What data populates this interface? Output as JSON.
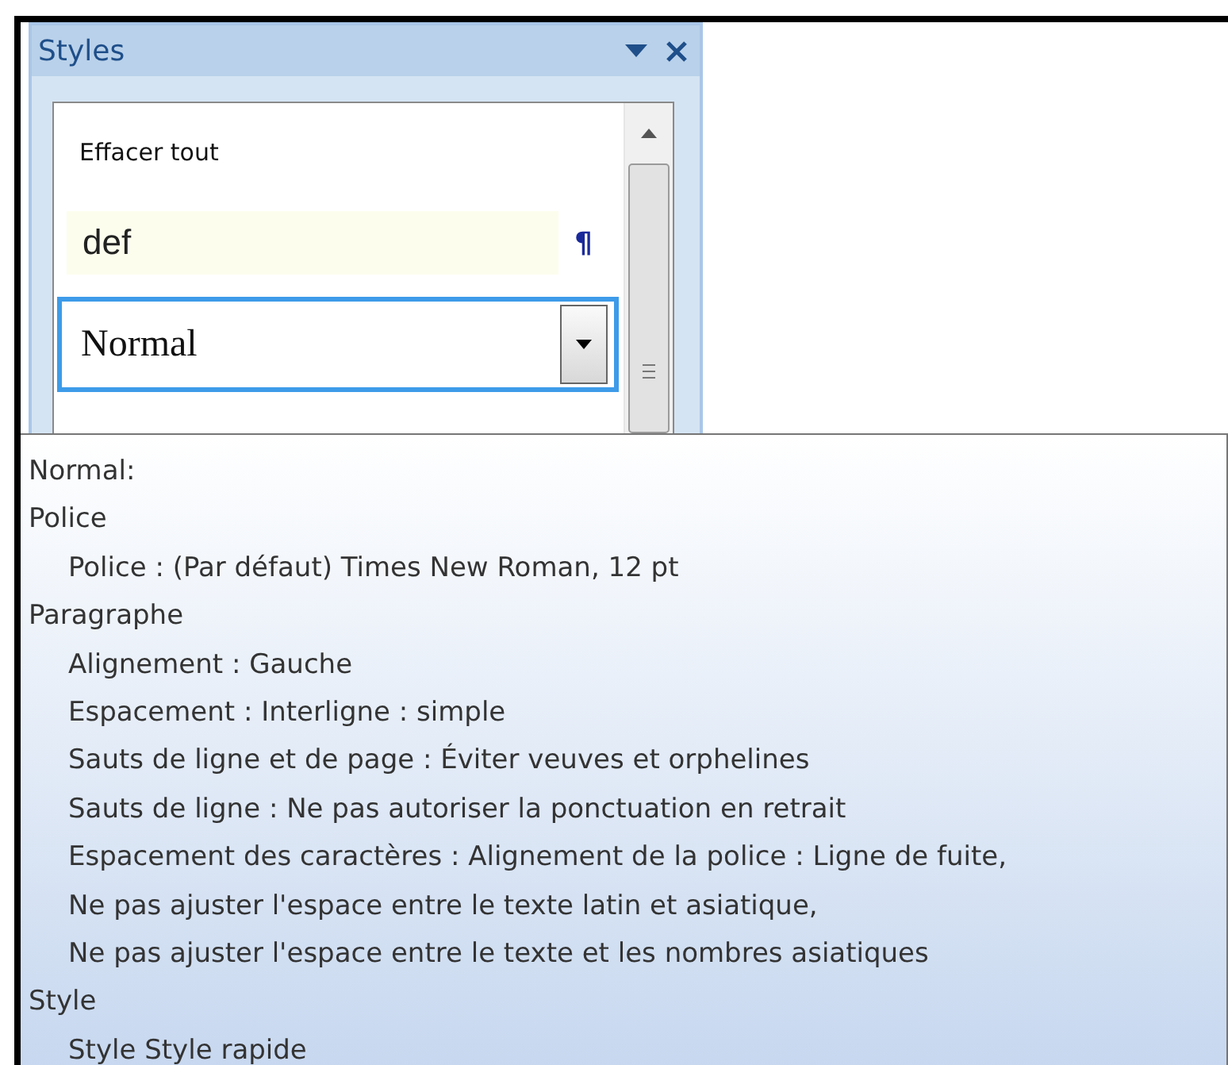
{
  "pane": {
    "title": "Styles",
    "styles": [
      {
        "kind": "command",
        "label": "Effacer tout",
        "highlighted": false
      },
      {
        "kind": "paragraph",
        "label": "def",
        "symbol": "¶",
        "highlighted": true
      },
      {
        "kind": "dropdown",
        "label": "Normal",
        "highlighted": false
      }
    ]
  },
  "tooltip": {
    "title": "Normal:",
    "sections": [
      {
        "heading": "Police",
        "lines": [
          "Police :  (Par défaut) Times New Roman, 12 pt"
        ]
      },
      {
        "heading": "Paragraphe",
        "lines": [
          "Alignement :  Gauche",
          "Espacement :  Interligne : simple",
          "Sauts de ligne et de page :  Éviter veuves et orphelines",
          "Sauts de ligne :  Ne pas autoriser la ponctuation en retrait",
          "Espacement des caractères :  Alignement de la police : Ligne de fuite,",
          "Ne pas ajuster l'espace entre le texte latin et asiatique,",
          "Ne pas ajuster l'espace entre le texte et les nombres asiatiques"
        ]
      },
      {
        "heading": "Style",
        "lines": [
          "Style Style rapide"
        ]
      }
    ]
  }
}
